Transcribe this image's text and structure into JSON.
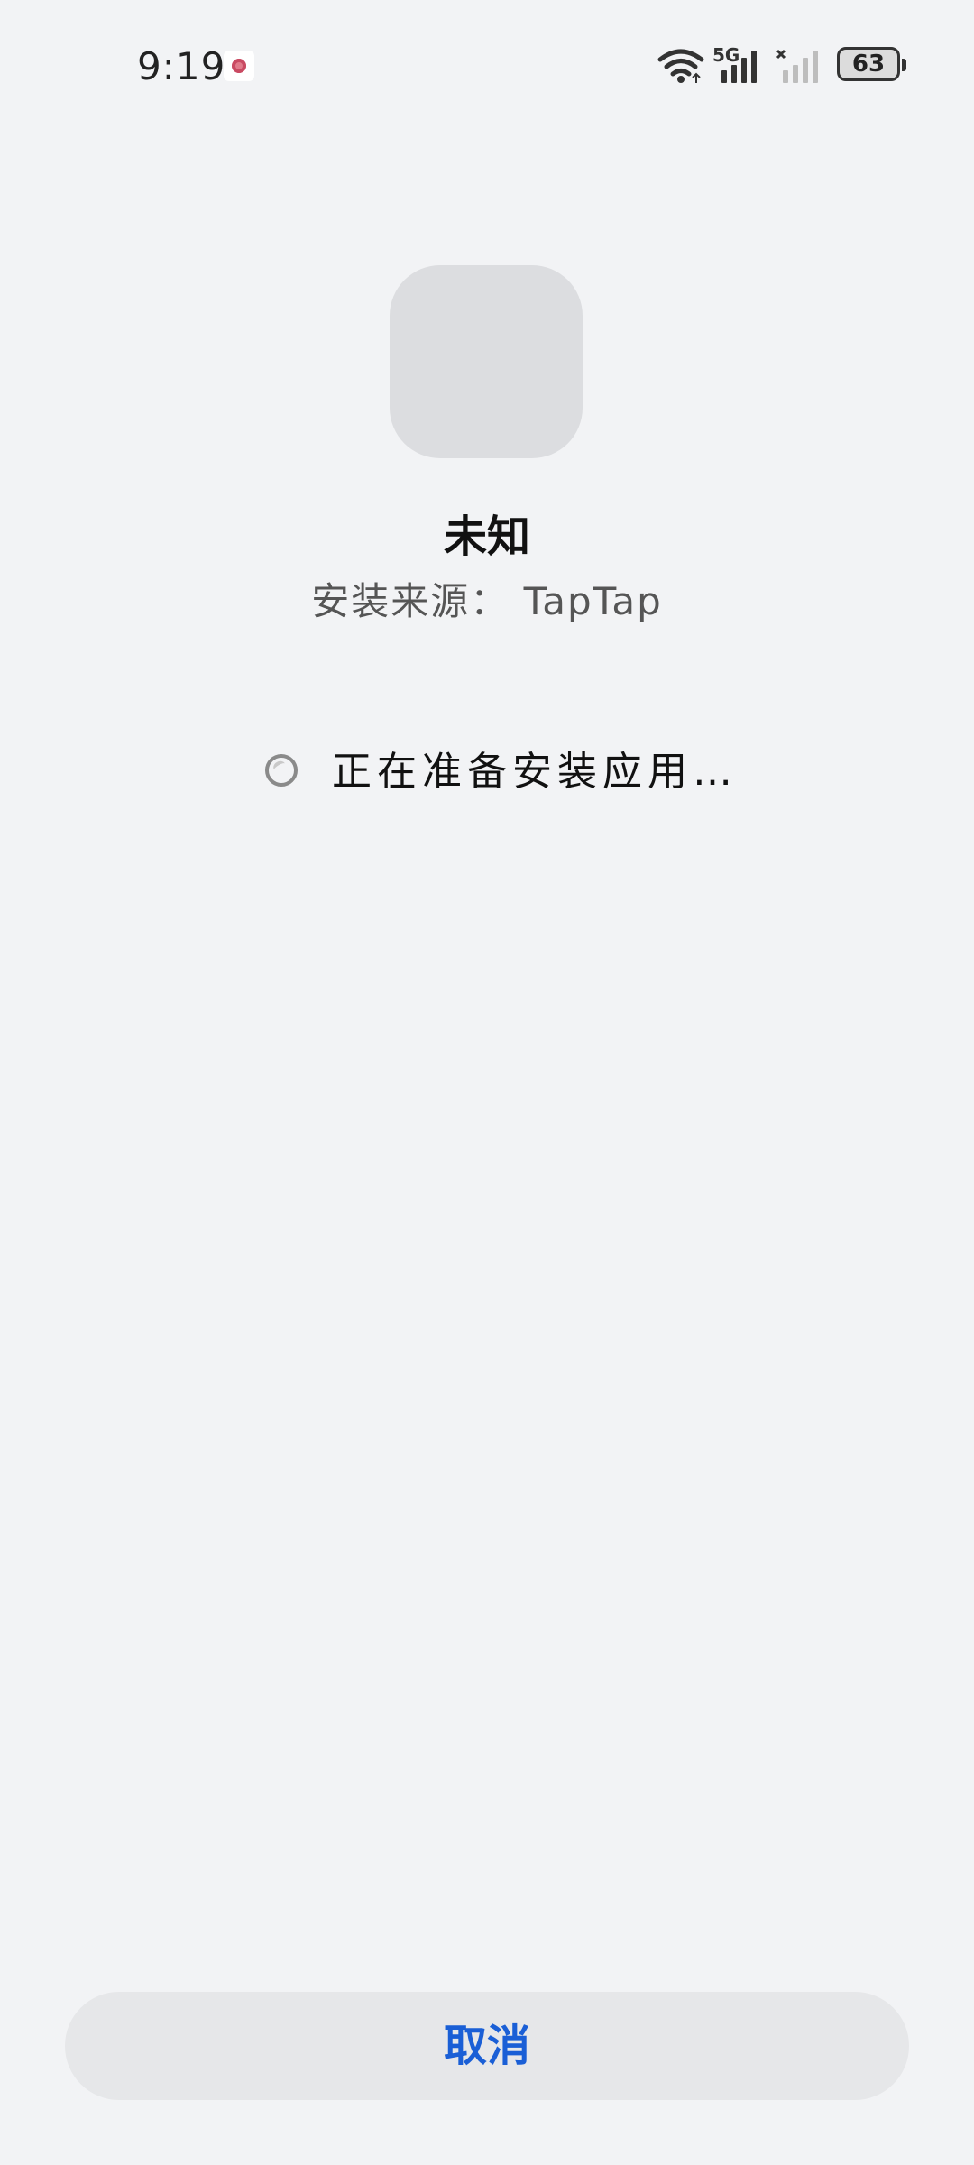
{
  "status_bar": {
    "time": "9:19",
    "network_type": "5G",
    "battery_level": "63",
    "icons": {
      "notification": "notification-app-icon",
      "wifi": "wifi-icon",
      "signal_primary": "signal-bars-icon",
      "signal_secondary": "signal-bars-no-service-icon",
      "battery": "battery-icon"
    }
  },
  "app": {
    "name": "未知",
    "install_source": "安装来源： TapTap",
    "icon_placeholder_color": "#dcdde0"
  },
  "progress": {
    "status_text": "正在准备安装应用…"
  },
  "actions": {
    "cancel_label": "取消",
    "cancel_color": "#1a5fd6"
  },
  "colors": {
    "background": "#f2f3f5",
    "button_background": "#e6e7e9"
  }
}
